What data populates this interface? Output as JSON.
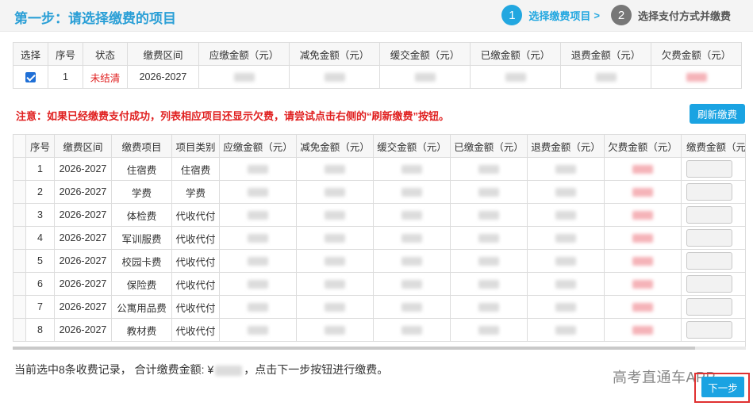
{
  "header": {
    "title": "第一步：请选择缴费的项目",
    "steps": [
      {
        "num": "1",
        "label": "选择缴费项目",
        "arrow": ">"
      },
      {
        "num": "2",
        "label": "选择支付方式并缴费"
      }
    ]
  },
  "top_table": {
    "headers": [
      "选择",
      "序号",
      "状态",
      "缴费区间",
      "应缴金额（元）",
      "减免金额（元）",
      "缓交金额（元）",
      "已缴金额（元）",
      "退费金额（元）",
      "欠费金额（元）"
    ],
    "row": {
      "seq": "1",
      "status": "未结清",
      "period": "2026-2027"
    }
  },
  "notice": "注意：如果已经缴费支付成功，列表相应项目还显示欠费，请尝试点击右侧的“刷新缴费”按钮。",
  "refresh_label": "刷新缴费",
  "bottom_table": {
    "headers": [
      "",
      "序号",
      "缴费区间",
      "缴费项目",
      "项目类别",
      "应缴金额（元）",
      "减免金额（元）",
      "缓交金额（元）",
      "已缴金额（元）",
      "退费金额（元）",
      "欠费金额（元）",
      "缴费金额（元）"
    ],
    "rows": [
      {
        "seq": "1",
        "period": "2026-2027",
        "item": "住宿费",
        "category": "住宿费"
      },
      {
        "seq": "2",
        "period": "2026-2027",
        "item": "学费",
        "category": "学费"
      },
      {
        "seq": "3",
        "period": "2026-2027",
        "item": "体检费",
        "category": "代收代付"
      },
      {
        "seq": "4",
        "period": "2026-2027",
        "item": "军训服费",
        "category": "代收代付"
      },
      {
        "seq": "5",
        "period": "2026-2027",
        "item": "校园卡费",
        "category": "代收代付"
      },
      {
        "seq": "6",
        "period": "2026-2027",
        "item": "保险费",
        "category": "代收代付"
      },
      {
        "seq": "7",
        "period": "2026-2027",
        "item": "公寓用品费",
        "category": "代收代付"
      },
      {
        "seq": "8",
        "period": "2026-2027",
        "item": "教材费",
        "category": "代收代付"
      }
    ]
  },
  "summary": {
    "prefix": "当前选中8条收费记录， 合计缴费金额: ¥",
    "suffix": "，点击下一步按钮进行缴费。"
  },
  "watermark": "高考直通车APP",
  "next_label": "下一步",
  "colors": {
    "accent": "#1aa3e2",
    "title": "#2a9fd6",
    "warning": "#e02020"
  }
}
